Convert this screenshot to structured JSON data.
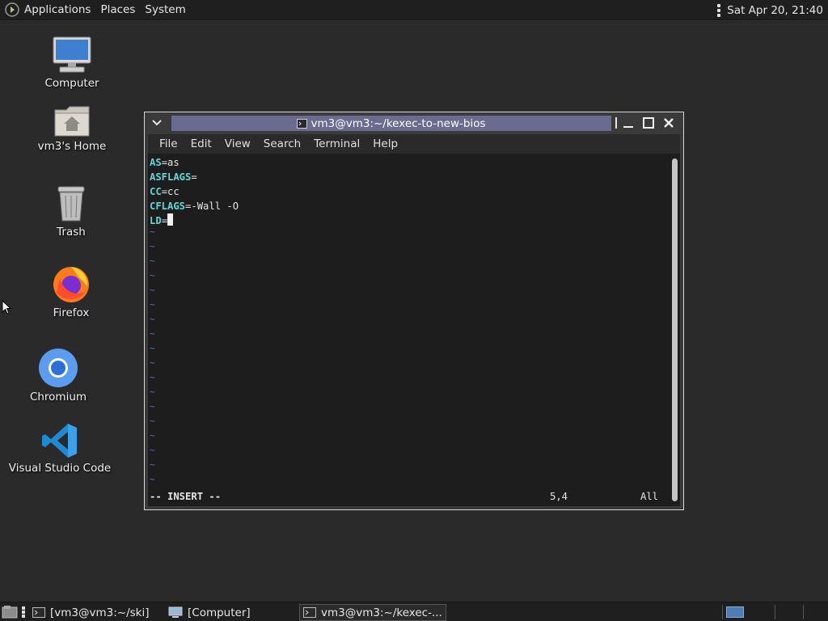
{
  "top_panel": {
    "applications": "Applications",
    "places": "Places",
    "system": "System",
    "clock": "Sat Apr 20, 21:40"
  },
  "desktop": {
    "icons": [
      {
        "label": "Computer"
      },
      {
        "label": "vm3's Home"
      },
      {
        "label": "Trash"
      },
      {
        "label": "Firefox"
      },
      {
        "label": "Chromium"
      },
      {
        "label": "Visual Studio Code"
      }
    ]
  },
  "terminal": {
    "title": "vm3@vm3:~/kexec-to-new-bios",
    "menu": [
      "File",
      "Edit",
      "View",
      "Search",
      "Terminal",
      "Help"
    ],
    "lines": [
      {
        "key": "AS",
        "value": "=as"
      },
      {
        "key": "ASFLAGS",
        "value": "="
      },
      {
        "key": "CC",
        "value": "=cc"
      },
      {
        "key": "CFLAGS",
        "value": "=-Wall -O"
      },
      {
        "key": "LD",
        "value": "="
      }
    ],
    "tilde": "~",
    "status_mode": "-- INSERT --",
    "status_position": "5,4",
    "status_scroll": "All"
  },
  "taskbar": {
    "tasks": [
      {
        "label": "[vm3@vm3:~/ski]"
      },
      {
        "label": "[Computer]"
      },
      {
        "label": "vm3@vm3:~/kexec-..."
      }
    ]
  },
  "colors": {
    "title_strip": "#6b6b92",
    "vim_keyword": "#5fd7d7",
    "vim_tilde": "#5b74b8",
    "workspace": "#4d7db3"
  }
}
